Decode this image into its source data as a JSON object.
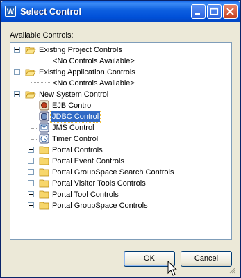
{
  "window": {
    "title": "Select Control"
  },
  "labels": {
    "available": "Available Controls:"
  },
  "tree": {
    "existing_project": "Existing Project Controls",
    "existing_project_empty": "<No Controls Available>",
    "existing_application": "Existing Application Controls",
    "existing_application_empty": "<No Controls Available>",
    "new_system": "New System Control",
    "system_items": [
      "EJB Control",
      "JDBC Control",
      "JMS Control",
      "Timer Control"
    ],
    "portal_groups": [
      "Portal Controls",
      "Portal Event Controls",
      "Portal GroupSpace Search Controls",
      "Portal Visitor Tools Controls",
      "Portal Tool Controls",
      "Portal GroupSpace Controls"
    ]
  },
  "buttons": {
    "ok": "OK",
    "cancel": "Cancel"
  },
  "colors": {
    "title_bar": "#0054e3",
    "selection": "#316ac5",
    "dialog_bg": "#ece9d8"
  }
}
